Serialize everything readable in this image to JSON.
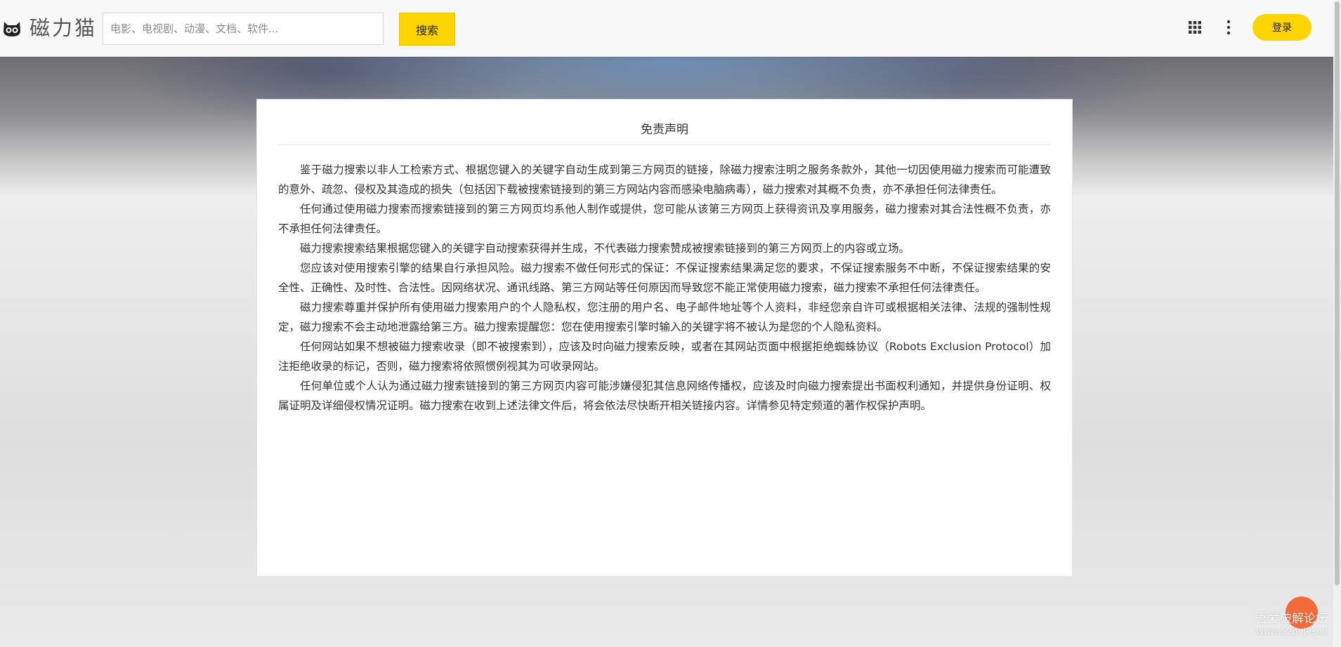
{
  "header": {
    "logo_text": "磁力猫",
    "search_placeholder": "电影、电视剧、动漫、文档、软件...",
    "search_button": "搜索",
    "login_button": "登录"
  },
  "disclaimer": {
    "title": "免责声明",
    "paragraphs": [
      "鉴于磁力搜索以非人工检索方式、根据您键入的关键字自动生成到第三方网页的链接，除磁力搜索注明之服务条款外，其他一切因使用磁力搜索而可能遭致的意外、疏忽、侵权及其造成的损失（包括因下载被搜索链接到的第三方网站内容而感染电脑病毒），磁力搜索对其概不负责，亦不承担任何法律责任。",
      "任何通过使用磁力搜索而搜索链接到的第三方网页均系他人制作或提供，您可能从该第三方网页上获得资讯及享用服务，磁力搜索对其合法性概不负责，亦不承担任何法律责任。",
      "磁力搜索搜索结果根据您键入的关键字自动搜索获得并生成，不代表磁力搜索赞成被搜索链接到的第三方网页上的内容或立场。",
      "您应该对使用搜索引擎的结果自行承担风险。磁力搜索不做任何形式的保证：不保证搜索结果满足您的要求，不保证搜索服务不中断，不保证搜索结果的安全性、正确性、及时性、合法性。因网络状况、通讯线路、第三方网站等任何原因而导致您不能正常使用磁力搜索，磁力搜索不承担任何法律责任。",
      "磁力搜索尊重并保护所有使用磁力搜索用户的个人隐私权，您注册的用户名、电子邮件地址等个人资料，非经您亲自许可或根据相关法律、法规的强制性规定，磁力搜索不会主动地泄露给第三方。磁力搜索提醒您：您在使用搜索引擎时输入的关键字将不被认为是您的个人隐私资料。",
      "任何网站如果不想被磁力搜索收录（即不被搜索到），应该及时向磁力搜索反映，或者在其网站页面中根据拒绝蜘蛛协议（Robots Exclusion Protocol）加注拒绝收录的标记，否则，磁力搜索将依照惯例视其为可收录网站。",
      "任何单位或个人认为通过磁力搜索链接到的第三方网页内容可能涉嫌侵犯其信息网络传播权，应该及时向磁力搜索提出书面权利通知，并提供身份证明、权属证明及详细侵权情况证明。磁力搜索在收到上述法律文件后，将会依法尽快断开相关链接内容。详情参见特定频道的著作权保护声明。"
    ]
  },
  "watermark": {
    "site_name": "吾爱破解论坛",
    "url": "www.52pojie.cn"
  },
  "colors": {
    "accent": "#ffd400",
    "badge": "#f26b3a"
  }
}
